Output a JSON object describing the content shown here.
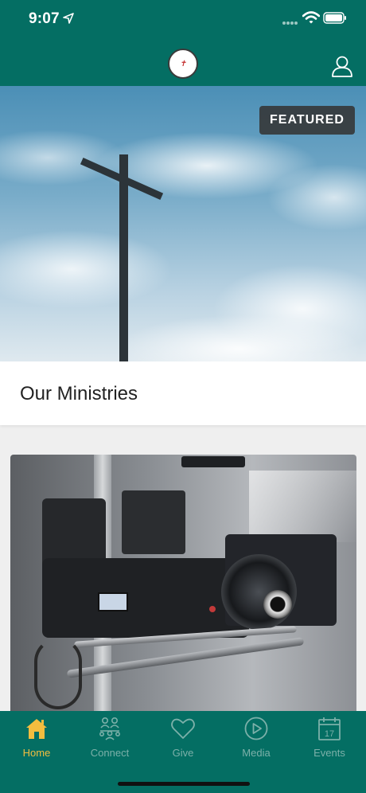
{
  "status_bar": {
    "time": "9:07"
  },
  "header": {
    "logo_text": "New Life",
    "profile_icon": "user-icon"
  },
  "hero": {
    "badge": "FEATURED",
    "image": "cross-against-sky"
  },
  "section": {
    "title": "Our Ministries"
  },
  "media_card": {
    "image": "broadcast-camera"
  },
  "tabs": [
    {
      "label": "Home",
      "icon": "home-icon",
      "active": true
    },
    {
      "label": "Connect",
      "icon": "connect-icon",
      "active": false
    },
    {
      "label": "Give",
      "icon": "heart-icon",
      "active": false
    },
    {
      "label": "Media",
      "icon": "play-icon",
      "active": false
    },
    {
      "label": "Events",
      "icon": "calendar-icon",
      "active": false
    }
  ],
  "colors": {
    "brand": "#046e63",
    "active_tab": "#f3bd3f",
    "inactive_tab": "#7cb0a9"
  }
}
